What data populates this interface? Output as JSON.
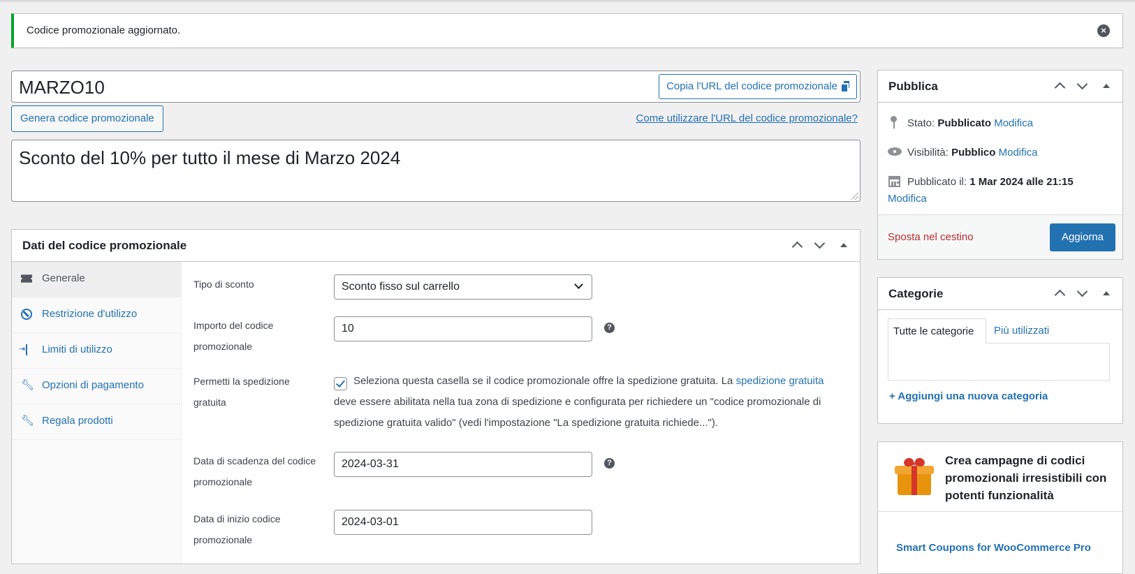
{
  "notice": {
    "message": "Codice promozionale aggiornato."
  },
  "coupon": {
    "code": "MARZO10",
    "copy_url_label": "Copia l'URL del codice promozionale",
    "generate_label": "Genera codice promozionale",
    "how_to_link": "Come utilizzare l'URL del codice promozionale?",
    "description": "Sconto del 10% per tutto il mese di Marzo 2024"
  },
  "coupon_data": {
    "title": "Dati del codice promozionale",
    "tabs": [
      {
        "label": "Generale",
        "icon": "ticket-icon"
      },
      {
        "label": "Restrizione d'utilizzo",
        "icon": "ban-icon"
      },
      {
        "label": "Limiti di utilizzo",
        "icon": "arrows-icon"
      },
      {
        "label": "Opzioni di pagamento",
        "icon": "wrench-icon"
      },
      {
        "label": "Regala prodotti",
        "icon": "wrench-icon"
      }
    ],
    "fields": {
      "discount_type_label": "Tipo di sconto",
      "discount_type_value": "Sconto fisso sul carrello",
      "amount_label": "Importo del codice promozionale",
      "amount_value": "10",
      "free_shipping_label": "Permetti la spedizione gratuita",
      "free_shipping_checked": true,
      "free_shipping_desc_1": "Seleziona questa casella se il codice promozionale offre la spedizione gratuita. La ",
      "free_shipping_link": "spedizione gratuita",
      "free_shipping_desc_2": " deve essere abilitata nella tua zona di spedizione e configurata per richiedere un \"codice promozionale di spedizione gratuita valido\" (vedi l'impostazione \"La spedizione gratuita richiede...\").",
      "expiry_label": "Data di scadenza del codice promozionale",
      "expiry_value": "2024-03-31",
      "start_label": "Data di inizio codice promozionale",
      "start_value": "2024-03-01"
    }
  },
  "publish": {
    "title": "Pubblica",
    "status_label": "Stato:",
    "status_value": "Pubblicato",
    "visibility_label": "Visibilità:",
    "visibility_value": "Pubblico",
    "published_label": "Pubblicato il:",
    "published_value": "1 Mar 2024 alle 21:15",
    "edit_label": "Modifica",
    "trash_label": "Sposta nel cestino",
    "update_label": "Aggiorna"
  },
  "categories": {
    "title": "Categorie",
    "tab_all": "Tutte le categorie",
    "tab_popular": "Più utilizzati",
    "add_new": "+ Aggiungi una nuova categoria"
  },
  "promo": {
    "headline": "Crea campagne di codici promozionali irresistibili con potenti funzionalità",
    "link": "Smart Coupons for WooCommerce Pro"
  },
  "colors": {
    "accent": "#2271b1",
    "success": "#00a32a",
    "danger": "#b32d2e"
  }
}
